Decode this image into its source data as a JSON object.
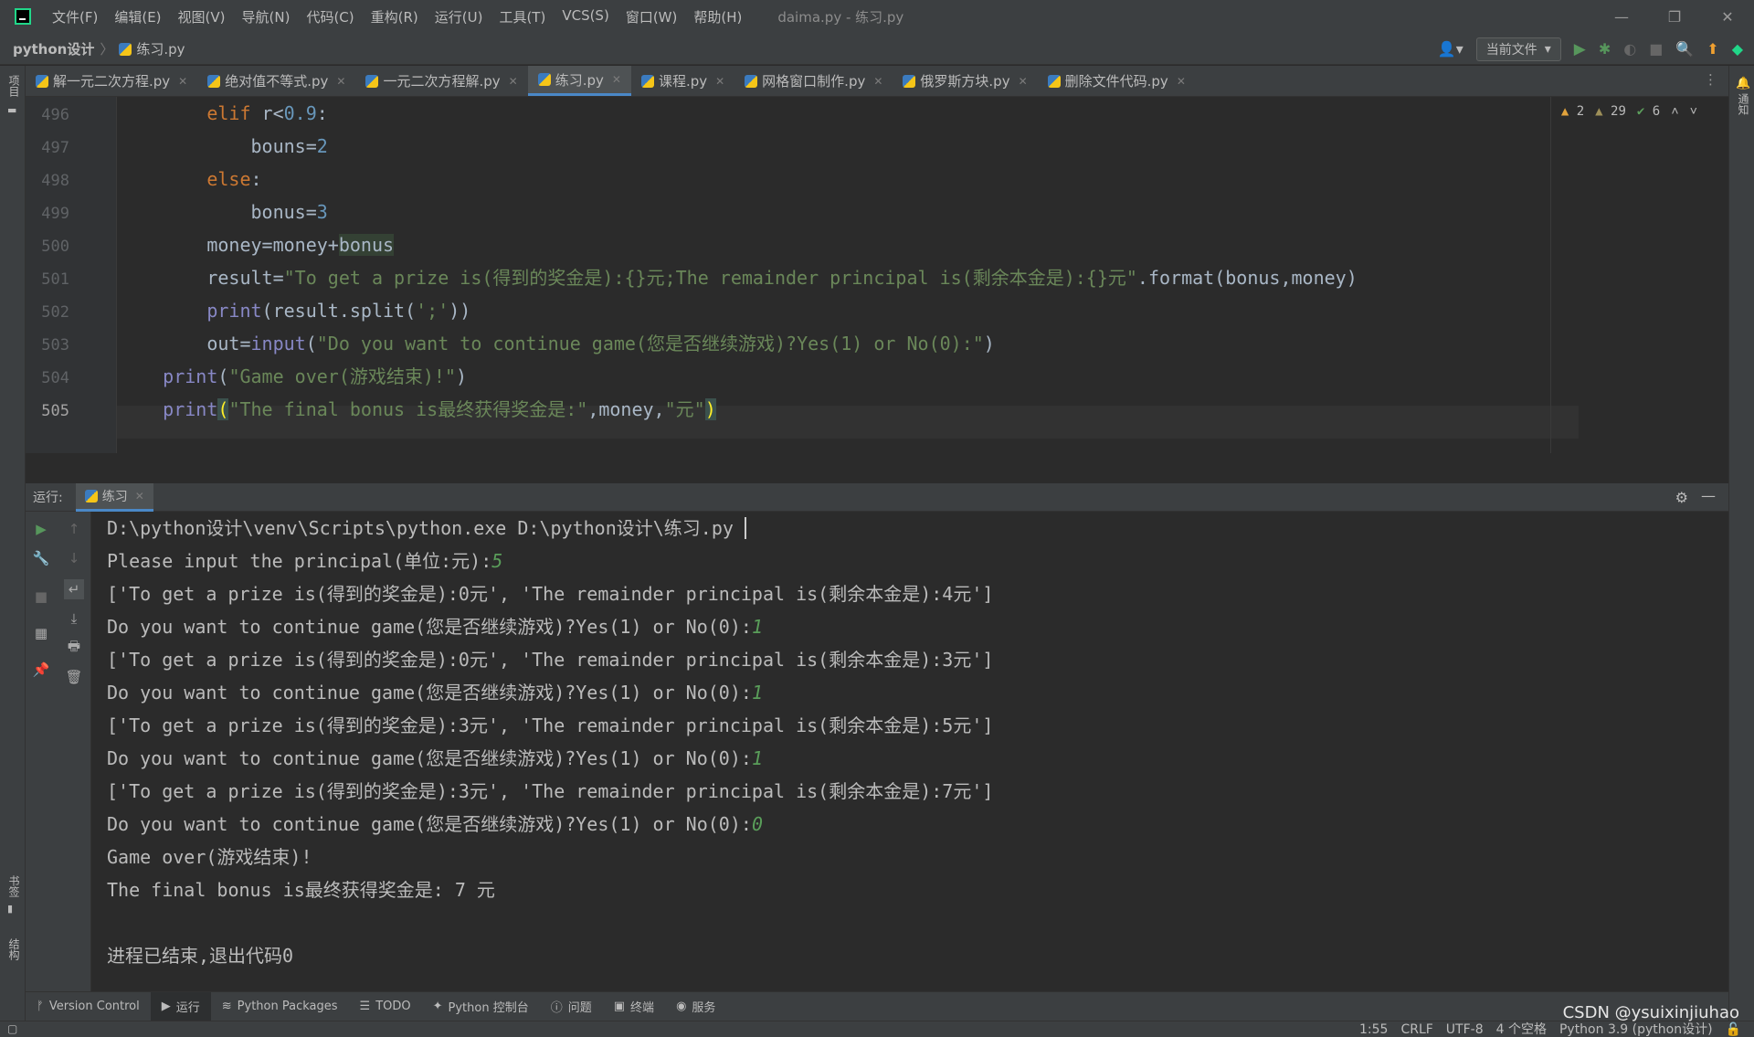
{
  "window": {
    "menus": [
      "文件(F)",
      "编辑(E)",
      "视图(V)",
      "导航(N)",
      "代码(C)",
      "重构(R)",
      "运行(U)",
      "工具(T)",
      "VCS(S)",
      "窗口(W)",
      "帮助(H)"
    ],
    "title": "daima.py - 练习.py",
    "controls": {
      "minimize": "—",
      "restore": "❐",
      "close": "✕"
    }
  },
  "navbar": {
    "project": "python设计",
    "file": "练习.py",
    "config_select": "当前文件"
  },
  "left_strip": {
    "project_label": "项目",
    "bookmarks_label": "书签",
    "structure_label": "结构"
  },
  "right_strip": {
    "notifications_label": "通知"
  },
  "tabs": [
    {
      "label": "解一元二次方程.py",
      "active": false
    },
    {
      "label": "绝对值不等式.py",
      "active": false
    },
    {
      "label": "一元二次方程解.py",
      "active": false
    },
    {
      "label": "练习.py",
      "active": true
    },
    {
      "label": "课程.py",
      "active": false
    },
    {
      "label": "网格窗口制作.py",
      "active": false
    },
    {
      "label": "俄罗斯方块.py",
      "active": false
    },
    {
      "label": "删除文件代码.py",
      "active": false
    }
  ],
  "inspections": {
    "warnings": "2",
    "weak_warnings": "29",
    "ok": "6"
  },
  "editor": {
    "line_numbers": [
      "496",
      "497",
      "498",
      "499",
      "500",
      "501",
      "502",
      "503",
      "504",
      "505"
    ],
    "current_line": "505"
  },
  "run_panel": {
    "label": "运行:",
    "tab": "练习",
    "console": [
      {
        "text": "D:\\python设计\\venv\\Scripts\\python.exe D:\\python设计\\练习.py "
      },
      {
        "text": "Please input the principal(单位:元):",
        "input": "5"
      },
      {
        "text": "['To get a prize is(得到的奖金是):0元', 'The remainder principal is(剩余本金是):4元']"
      },
      {
        "text": "Do you want to continue game(您是否继续游戏)?Yes(1) or No(0):",
        "input": "1"
      },
      {
        "text": "['To get a prize is(得到的奖金是):0元', 'The remainder principal is(剩余本金是):3元']"
      },
      {
        "text": "Do you want to continue game(您是否继续游戏)?Yes(1) or No(0):",
        "input": "1"
      },
      {
        "text": "['To get a prize is(得到的奖金是):3元', 'The remainder principal is(剩余本金是):5元']"
      },
      {
        "text": "Do you want to continue game(您是否继续游戏)?Yes(1) or No(0):",
        "input": "1"
      },
      {
        "text": "['To get a prize is(得到的奖金是):3元', 'The remainder principal is(剩余本金是):7元']"
      },
      {
        "text": "Do you want to continue game(您是否继续游戏)?Yes(1) or No(0):",
        "input": "0"
      },
      {
        "text": "Game over(游戏结束)!"
      },
      {
        "text": "The final bonus is最终获得奖金是: 7 元"
      },
      {
        "text": ""
      },
      {
        "text": "进程已结束,退出代码0"
      }
    ]
  },
  "bottom_tabs": [
    "Version Control",
    "运行",
    "Python Packages",
    "TODO",
    "Python 控制台",
    "问题",
    "终端",
    "服务"
  ],
  "status": {
    "position": "1:55",
    "line_sep": "CRLF",
    "encoding": "UTF-8",
    "indent": "4 个空格",
    "interpreter": "Python 3.9 (python设计)"
  },
  "watermark": "CSDN @ysuixinjiuhao"
}
